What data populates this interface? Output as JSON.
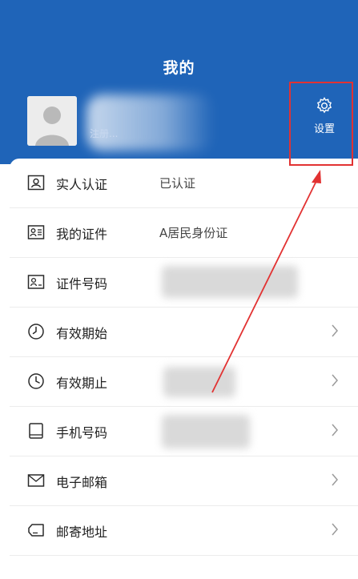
{
  "header": {
    "title": "我的",
    "username_visible": "注册...",
    "settings_label": "设置",
    "bg_color": "#1f64b8"
  },
  "menu": {
    "items": [
      {
        "label": "实人认证",
        "value": "已认证",
        "icon": "id-card-icon"
      },
      {
        "label": "我的证件",
        "value": "A居民身份证",
        "icon": "document-card-icon"
      },
      {
        "label": "证件号码",
        "value": "",
        "icon": "id-number-icon"
      },
      {
        "label": "有效期始",
        "value": "",
        "icon": "clock-start-icon"
      },
      {
        "label": "有效期止",
        "value": "",
        "icon": "clock-end-icon"
      },
      {
        "label": "手机号码",
        "value": "",
        "icon": "phone-icon"
      },
      {
        "label": "电子邮箱",
        "value": "",
        "icon": "mail-icon"
      },
      {
        "label": "邮寄地址",
        "value": "",
        "icon": "address-tag-icon"
      }
    ]
  },
  "annotation_color": "#e23232"
}
